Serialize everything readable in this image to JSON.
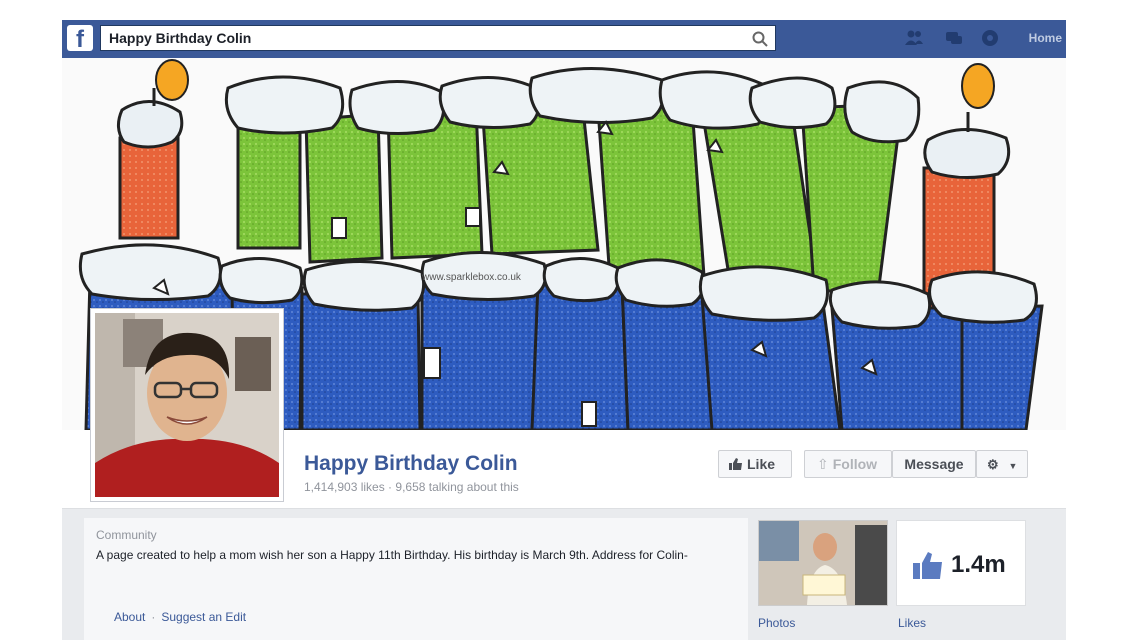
{
  "topbar": {
    "logo": "f",
    "search_value": "Happy Birthday Colin",
    "home_label": "Home"
  },
  "cover": {
    "watermark": "www.sparklebox.co.uk"
  },
  "profile": {
    "name": "Happy Birthday Colin",
    "stats": "1,414,903 likes · 9,658 talking about this"
  },
  "actions": {
    "like": "Like",
    "follow": "Follow",
    "message": "Message"
  },
  "about": {
    "category": "Community",
    "description": "A page created to help a mom wish her son a Happy 11th Birthday. His birthday is March 9th. Address for Colin-",
    "about_link": "About",
    "separator": "·",
    "suggest_link": "Suggest an Edit"
  },
  "thumbs": {
    "photos_label": "Photos",
    "likes_label": "Likes",
    "likes_count": "1.4m"
  },
  "colors": {
    "facebook_blue": "#3b5998",
    "letters_green": "#7cc43a",
    "letters_blue": "#2e5cc0",
    "candle_orange": "#e8643a"
  }
}
